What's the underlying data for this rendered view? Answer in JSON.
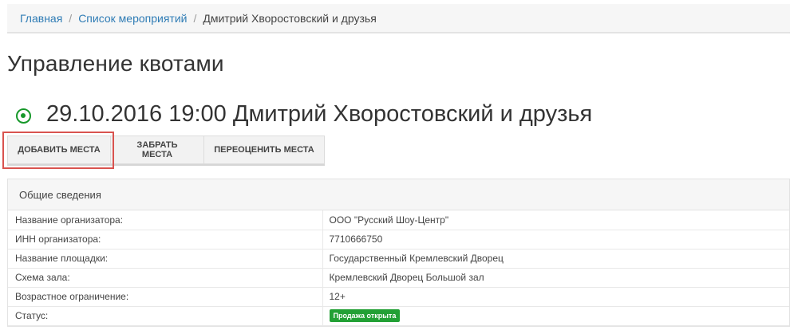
{
  "breadcrumb": {
    "home": "Главная",
    "events": "Список мероприятий",
    "current": "Дмитрий Хворостовский и друзья"
  },
  "page_title": "Управление квотами",
  "event": {
    "title": "29.10.2016 19:00 Дмитрий Хворостовский и друзья",
    "status_color": "#17982a"
  },
  "actions": {
    "add_label": "ДОБАВИТЬ МЕСТА",
    "take_label": "ЗАБРАТЬ МЕСТА",
    "reprice_label": "ПЕРЕОЦЕНИТЬ МЕСТА"
  },
  "info_panel": {
    "heading": "Общие сведения",
    "rows": [
      {
        "key": "Название организатора:",
        "value": "ООО \"Русский Шоу-Центр\""
      },
      {
        "key": "ИНН организатора:",
        "value": "7710666750"
      },
      {
        "key": "Название площадки:",
        "value": "Государственный Кремлевский Дворец"
      },
      {
        "key": "Схема зала:",
        "value": "Кремлевский Дворец Большой зал"
      },
      {
        "key": "Возрастное ограничение:",
        "value": "12+"
      },
      {
        "key": "Статус:",
        "value": "Продажа открыта"
      }
    ]
  }
}
